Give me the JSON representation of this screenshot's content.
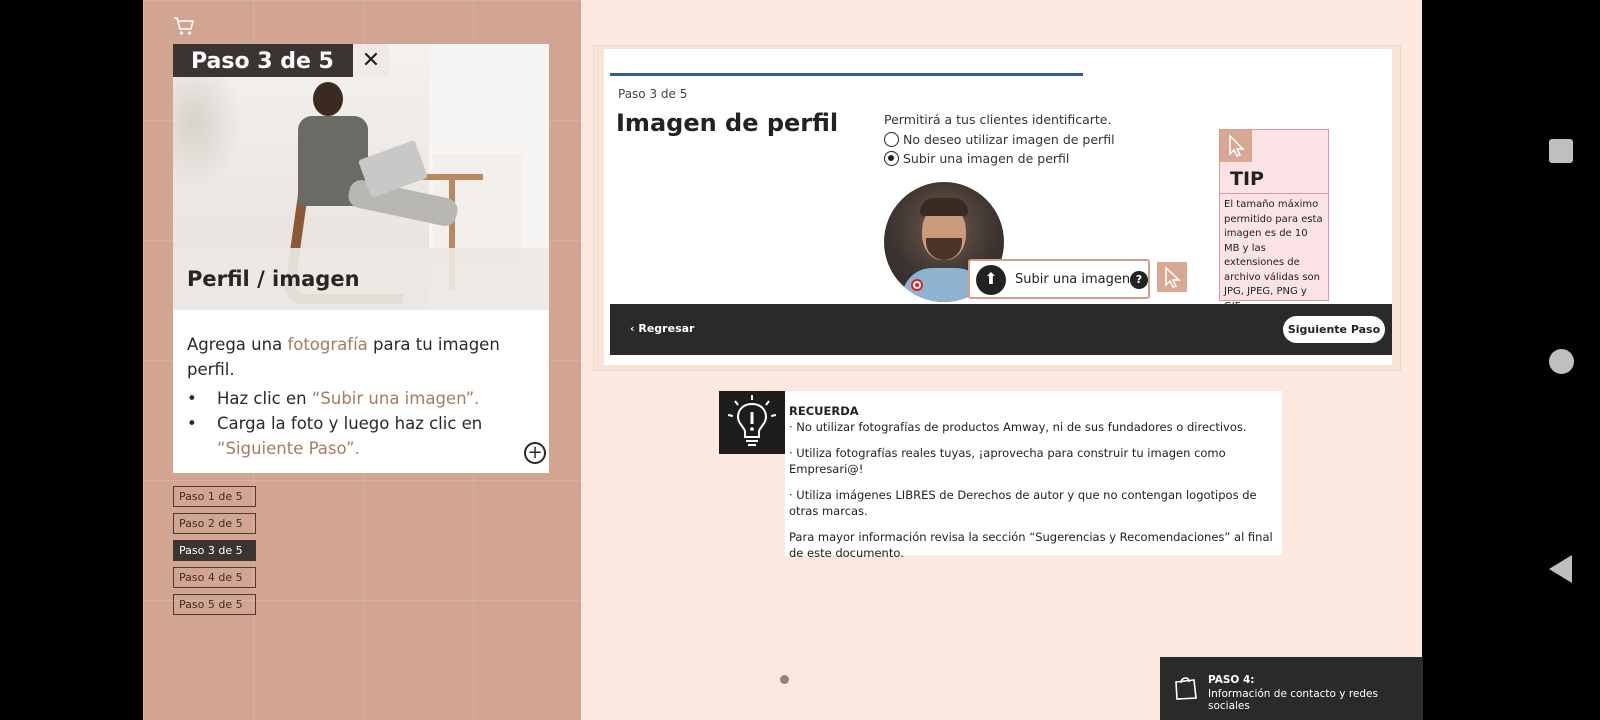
{
  "left": {
    "step_badge": "Paso 3 de 5",
    "close_symbol": "✕",
    "card_title": "Perfil / imagen",
    "body_text_1": "Agrega una ",
    "body_highlight_1": "fotografía",
    "body_text_2": " para tu imagen perfil.",
    "bullet_1_text": "Haz clic en ",
    "bullet_1_highlight": "“Subir una imagen”.",
    "bullet_2_text": "Carga la foto y luego haz clic en ",
    "bullet_2_highlight": "“Siguiente Paso”.",
    "plus_symbol": "+",
    "steps": [
      "Paso 1 de 5",
      "Paso 2 de 5",
      "Paso 3 de 5",
      "Paso 4 de 5",
      "Paso 5 de 5"
    ],
    "active_step": 3
  },
  "screenshot": {
    "progress_fraction": 0.6,
    "step_label": "Paso 3 de 5",
    "title": "Imagen de perfil",
    "description": "Permitirá a tus clientes identificarte.",
    "option_no": "No deseo utilizar imagen de perfil",
    "option_yes": "Subir una imagen de perfil",
    "upload_label": "Subir una imagen",
    "help_symbol": "?",
    "tip_title": "TIP",
    "tip_text": "El tamaño máximo permitido para esta imagen es de 10 MB y las extensiones de archivo válidas son JPG, JPEG, PNG y GIF.",
    "back_label": "Regresar",
    "next_label": "Siguiente Paso"
  },
  "remember": {
    "title": "RECUERDA",
    "line_1": "· No utilizar fotografías de productos Amway, ni de sus fundadores o directivos.",
    "line_2": "· Utiliza fotografías reales tuyas, ¡aprovecha para construir tu imagen como Empresari@!",
    "line_3": "· Utiliza imágenes LIBRES de Derechos de autor y que no contengan logotipos de otras marcas.",
    "line_4": "Para mayor información revisa la sección “Sugerencias y Recomendaciones” al final de este documento."
  },
  "next_section": {
    "label": "PASO 4:",
    "description": "Información de contacto y redes sociales"
  },
  "colors": {
    "left_panel": "#d1a592",
    "right_panel": "#fbe9df",
    "accent_text": "#a57c5f",
    "dark": "#2b2a2a",
    "progress": "#3a5a8c"
  }
}
